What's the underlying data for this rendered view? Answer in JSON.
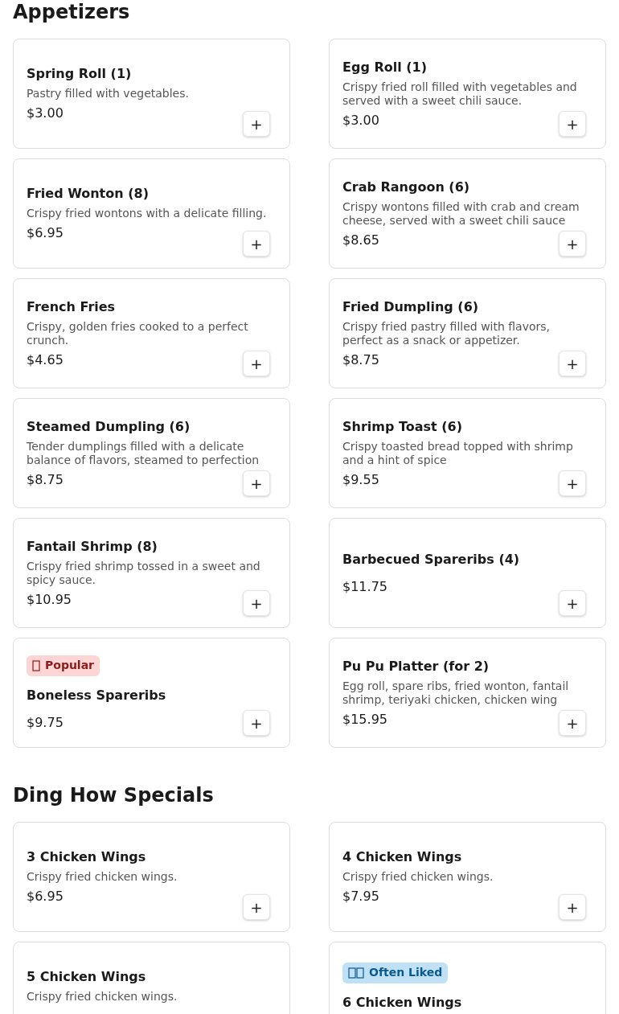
{
  "sections": [
    {
      "title": "Appetizers",
      "items": [
        {
          "name": "Spring Roll (1)",
          "description": "Pastry filled with vegetables.",
          "price": "$3.00",
          "add": "+"
        },
        {
          "name": "Egg Roll (1)",
          "description": "Crispy fried roll filled with vegetables and served with a sweet chili sauce.",
          "price": "$3.00",
          "add": "+"
        },
        {
          "name": "Fried Wonton (8)",
          "description": "Crispy fried wontons with a delicate filling.",
          "price": "$6.95",
          "add": "+"
        },
        {
          "name": "Crab Rangoon (6)",
          "description": "Crispy wontons filled with crab and cream cheese, served with a sweet chili sauce",
          "price": "$8.65",
          "add": "+"
        },
        {
          "name": "French Fries",
          "description": "Crispy, golden fries cooked to a perfect crunch.",
          "price": "$4.65",
          "add": "+"
        },
        {
          "name": "Fried Dumpling (6)",
          "description": "Crispy fried pastry filled with flavors, perfect as a snack or appetizer.",
          "price": "$8.75",
          "add": "+"
        },
        {
          "name": "Steamed Dumpling (6)",
          "description": "Tender dumplings filled with a delicate balance of flavors, steamed to perfection",
          "price": "$8.75",
          "add": "+"
        },
        {
          "name": "Shrimp Toast (6)",
          "description": "Crispy toasted bread topped with shrimp and a hint of spice",
          "price": "$9.55",
          "add": "+"
        },
        {
          "name": "Fantail Shrimp (8)",
          "description": "Crispy fried shrimp tossed in a sweet and spicy sauce.",
          "price": "$10.95",
          "add": "+"
        },
        {
          "name": "Barbecued Spareribs (4)",
          "price": "$11.75",
          "add": "+"
        },
        {
          "badge": {
            "kind": "popular",
            "label": "Popular"
          },
          "name": "Boneless Spareribs",
          "price": "$9.75",
          "add": "+"
        },
        {
          "name": "Pu Pu Platter (for 2)",
          "description": "Egg roll, spare ribs, fried wonton, fantail shrimp, teriyaki chicken, chicken wing",
          "price": "$15.95",
          "add": "+"
        }
      ]
    },
    {
      "title": "Ding How Specials",
      "items": [
        {
          "name": "3 Chicken Wings",
          "description": "Crispy fried chicken wings.",
          "price": "$6.95",
          "add": "+"
        },
        {
          "name": "4 Chicken Wings",
          "description": "Crispy fried chicken wings.",
          "price": "$7.95",
          "add": "+"
        },
        {
          "name": "5 Chicken Wings",
          "description": "Crispy fried chicken wings."
        },
        {
          "badge": {
            "kind": "liked",
            "label": "Often Liked"
          },
          "name": "6 Chicken Wings"
        }
      ]
    }
  ]
}
